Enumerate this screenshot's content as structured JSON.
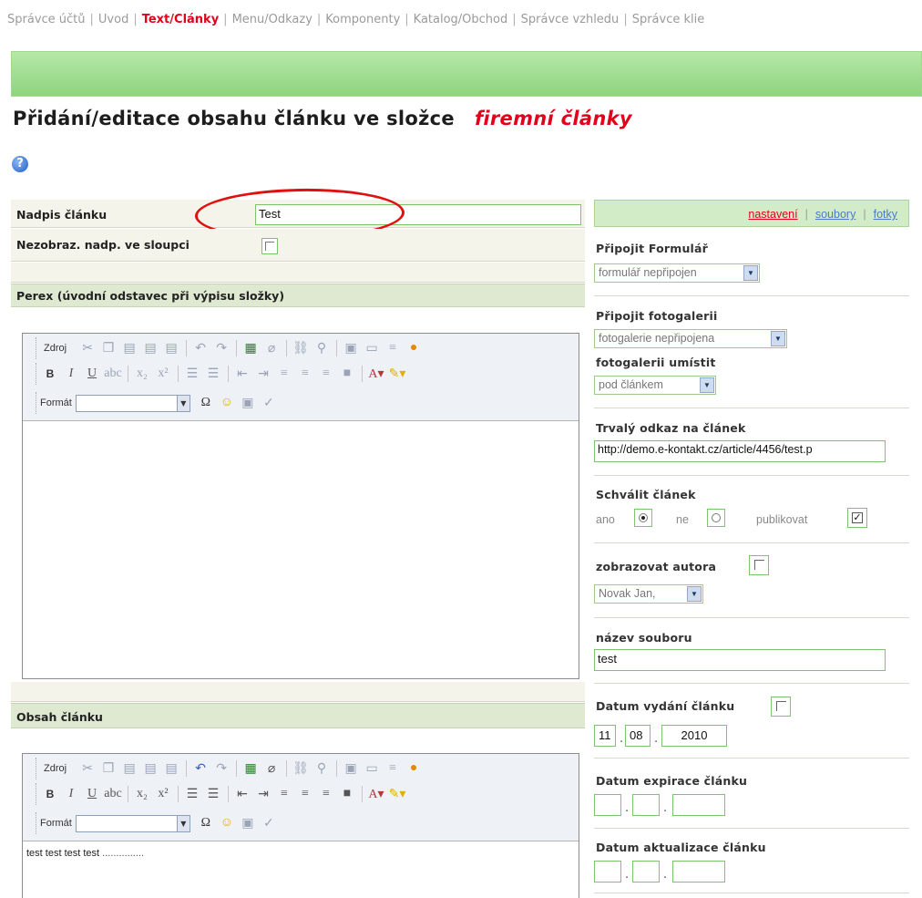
{
  "topnav": {
    "items": [
      {
        "label": "Správce účtů",
        "active": false
      },
      {
        "label": "Úvod",
        "active": false
      },
      {
        "label": "Text/Články",
        "active": true
      },
      {
        "label": "Menu/Odkazy",
        "active": false
      },
      {
        "label": "Komponenty",
        "active": false
      },
      {
        "label": "Katalog/Obchod",
        "active": false
      },
      {
        "label": "Správce vzhledu",
        "active": false
      },
      {
        "label": "Správce klie",
        "active": false
      }
    ],
    "separator": "|"
  },
  "page": {
    "title": "Přidání/editace obsahu článku ve složce",
    "folder": "firemní články",
    "help_icon": "question-help-icon"
  },
  "form": {
    "title_label": "Nadpis článku",
    "title_value": "Test",
    "hide_title_label": "Nezobraz. nadp. ve sloupci",
    "perex_label": "Perex (úvodní odstavec při výpisu složky)",
    "content_label": "Obsah článku",
    "content_text": "test test test test",
    "content_dots": "..............."
  },
  "editor": {
    "source_label": "Zdroj",
    "format_label": "Formát",
    "toolbar_icons_row1": [
      "cut-icon",
      "copy-icon",
      "paste-icon",
      "paste-text-icon",
      "paste-word-icon",
      "undo-icon",
      "redo-icon",
      "table-icon",
      "eraser-icon",
      "link-icon",
      "unlink-icon",
      "image-icon",
      "flash-icon",
      "hr-icon",
      "special-icon"
    ],
    "toolbar_icons_row2": [
      "bold-icon",
      "italic-icon",
      "underline-icon",
      "strike-icon",
      "subscript-icon",
      "superscript-icon",
      "ordered-list-icon",
      "bullet-list-icon",
      "outdent-icon",
      "indent-icon",
      "align-left-icon",
      "align-center-icon",
      "align-right-icon",
      "justify-icon",
      "text-color-icon",
      "bg-color-icon"
    ],
    "toolbar_icons_row3": [
      "omega-icon",
      "smiley-icon",
      "box-icon",
      "check-icon"
    ]
  },
  "right": {
    "tabs": [
      {
        "label": "nastavení",
        "active": true
      },
      {
        "label": "soubory",
        "active": false
      },
      {
        "label": "fotky",
        "active": false
      }
    ],
    "form_label": "Připojit Formulář",
    "form_value": "formulář nepřipojen",
    "gallery_label": "Připojit fotogalerii",
    "gallery_value": "fotogalerie nepřipojena",
    "gallery_pos_label": "fotogalerii umístit",
    "gallery_pos_value": "pod článkem",
    "permalink_label": "Trvalý odkaz na článek",
    "permalink_value": "http://demo.e-kontakt.cz/article/4456/test.p",
    "approve_label": "Schválit článek",
    "approve_yes": "ano",
    "approve_no": "ne",
    "publish_label": "publikovat",
    "author_label": "zobrazovat autora",
    "author_value": "Novak Jan,",
    "filename_label": "název souboru",
    "filename_value": "test",
    "release_label": "Datum vydání článku",
    "release_day": "11",
    "release_month": "08",
    "release_year": "2010",
    "expire_label": "Datum expirace článku",
    "update_label": "Datum aktualizace článku",
    "date_sep": "."
  },
  "colors": {
    "accent_red": "#e3001b",
    "green_bar": "#9fd88e",
    "field_border": "#7fc36e"
  }
}
